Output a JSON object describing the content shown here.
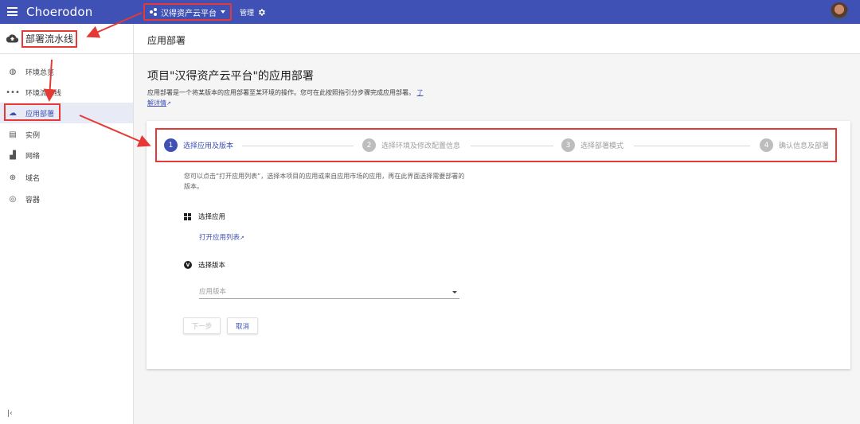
{
  "topbar": {
    "brand": "Choerodon",
    "project": "汉得资产云平台",
    "manage": "管理"
  },
  "sidebar": {
    "title": "部署流水线",
    "items": [
      {
        "label": "环境总览",
        "icon": "globe-icon"
      },
      {
        "label": "环境流水线",
        "icon": "pipeline-icon"
      },
      {
        "label": "应用部署",
        "icon": "cloud-deploy-icon",
        "active": true
      },
      {
        "label": "实例",
        "icon": "instance-icon"
      },
      {
        "label": "网络",
        "icon": "network-icon"
      },
      {
        "label": "域名",
        "icon": "domain-icon"
      },
      {
        "label": "容器",
        "icon": "container-icon"
      }
    ]
  },
  "main": {
    "header": "应用部署",
    "title": "项目\"汉得资产云平台\"的应用部署",
    "description": "应用部署是一个将某版本的应用部署至某环境的操作。您可在此按照指引分步骤完成应用部署。",
    "learn_more": "了解详情",
    "steps": [
      {
        "num": "1",
        "label": "选择应用及版本",
        "active": true
      },
      {
        "num": "2",
        "label": "选择环境及修改配置信息"
      },
      {
        "num": "3",
        "label": "选择部署模式"
      },
      {
        "num": "4",
        "label": "确认信息及部署"
      }
    ],
    "instruction": "您可以点击“打开应用列表”，选择本项目的应用或来自应用市场的应用，再在此界面选择需要部署的版本。",
    "select_app_label": "选择应用",
    "open_app_list": "打开应用列表",
    "select_version_label": "选择版本",
    "version_placeholder": "应用版本",
    "next_button": "下一步",
    "cancel_button": "取消"
  },
  "colors": {
    "primary": "#3f51b5",
    "annotation": "#e53935"
  }
}
